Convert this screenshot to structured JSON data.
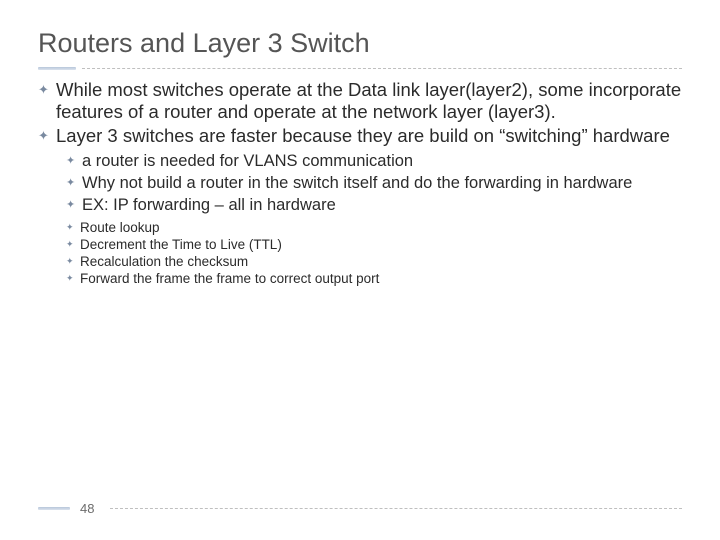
{
  "title": "Routers and Layer 3 Switch",
  "bullets": {
    "b1": "While most switches operate at the Data link layer(layer2), some incorporate features of a router and operate at the network layer (layer3).",
    "b2": "Layer 3 switches are faster because they are build on “switching” hardware",
    "sub": {
      "s1": " a router is needed for VLANS communication",
      "s2": "Why not build a router in the switch itself and do the forwarding in hardware",
      "s3": "EX: IP forwarding – all in hardware"
    },
    "subsub": {
      "t1": "Route lookup",
      "t2": "Decrement the Time to Live (TTL)",
      "t3": "Recalculation the checksum",
      "t4": "Forward the frame the frame to correct output port"
    }
  },
  "page": "48",
  "glyphs": {
    "bullet": "⚓"
  }
}
